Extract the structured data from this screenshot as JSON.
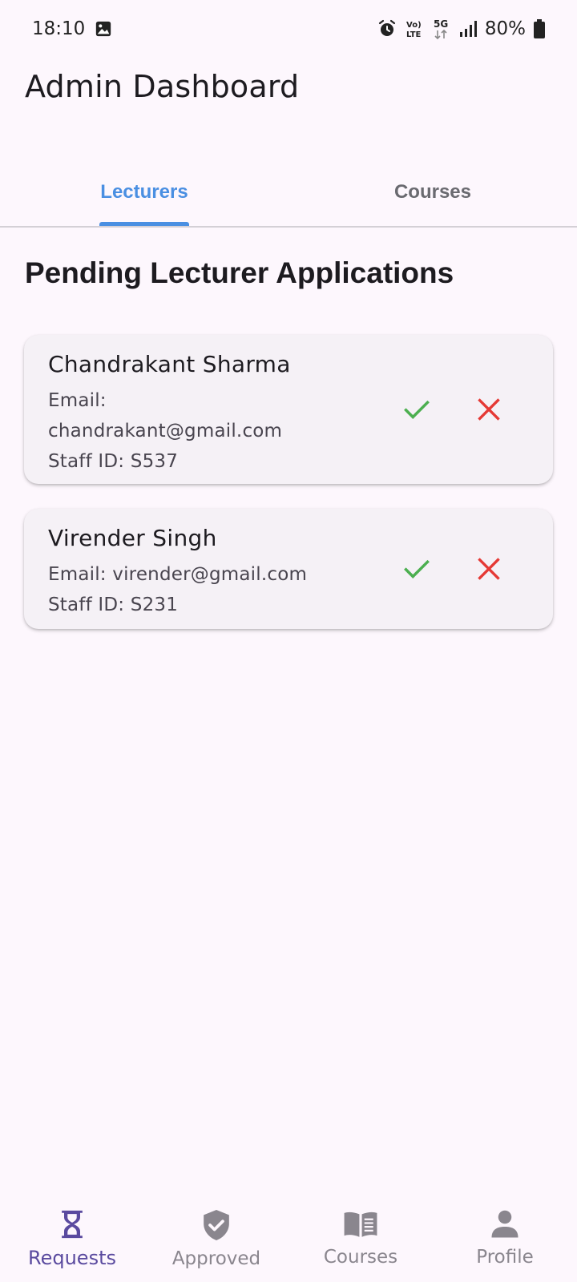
{
  "status_bar": {
    "time": "18:10",
    "battery": "80%",
    "network": "5G",
    "volte": "Vo) LTE",
    "icons": [
      "image-icon",
      "alarm-icon",
      "volte-icon",
      "5g-icon",
      "signal-icon",
      "battery-icon"
    ]
  },
  "app_bar": {
    "title": "Admin Dashboard"
  },
  "tabs": [
    {
      "label": "Lecturers",
      "active": true
    },
    {
      "label": "Courses",
      "active": false
    }
  ],
  "section": {
    "title": "Pending Lecturer Applications"
  },
  "applications": [
    {
      "name": "Chandrakant Sharma",
      "email_line1": "Email:",
      "email_line2": "chandrakant@gmail.com",
      "staff_id": "Staff ID: S537"
    },
    {
      "name": "Virender Singh",
      "email_line1": "Email: virender@gmail.com",
      "staff_id": "Staff ID: S231"
    }
  ],
  "bottom_nav": [
    {
      "label": "Requests",
      "icon": "hourglass-icon",
      "active": true
    },
    {
      "label": "Approved",
      "icon": "verified-shield-icon",
      "active": false
    },
    {
      "label": "Courses",
      "icon": "book-icon",
      "active": false
    },
    {
      "label": "Profile",
      "icon": "person-icon",
      "active": false
    }
  ],
  "colors": {
    "accent": "#4a8fe2",
    "approve": "#4caf50",
    "reject": "#e53935",
    "nav_active": "#5a4a9f",
    "background": "#fdf7fd"
  }
}
